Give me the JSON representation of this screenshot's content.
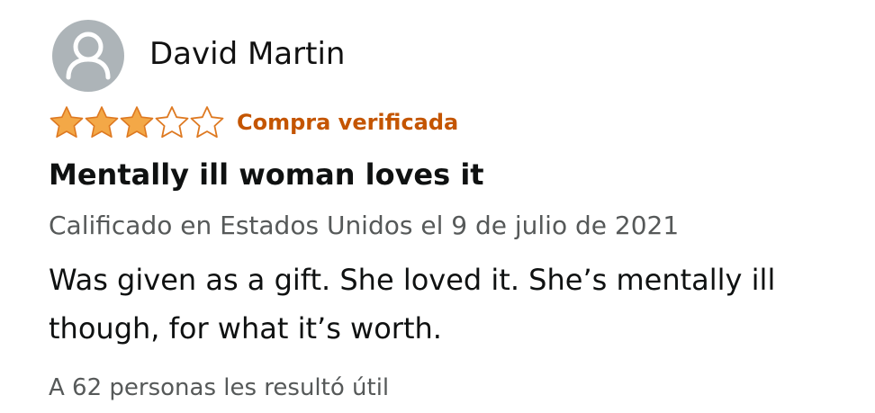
{
  "review": {
    "author": "David Martin",
    "rating": 3,
    "rating_max": 5,
    "star_icons": [
      "star-filled-icon",
      "star-filled-icon",
      "star-filled-icon",
      "star-empty-icon",
      "star-empty-icon"
    ],
    "verified_label": "Compra verificada",
    "title": "Mentally ill woman loves it",
    "meta": "Calificado en Estados Unidos el 9 de julio de 2021",
    "body": "Was given as a gift. She loved it. She’s mentally ill though, for what it’s worth.",
    "helpful": "A 62 personas les resultó útil"
  },
  "colors": {
    "star": "#f3a847",
    "star_outline": "#de7921",
    "verified": "#c45500",
    "avatar_bg": "#adb4b8",
    "avatar_fg": "#ffffff",
    "meta_text": "#565959",
    "main_text": "#0f1111"
  }
}
